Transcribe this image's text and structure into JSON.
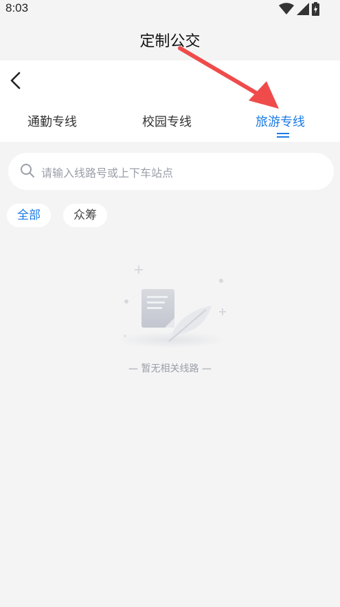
{
  "status_bar": {
    "time": "8:03"
  },
  "header": {
    "title": "定制公交"
  },
  "tabs": [
    {
      "label": "通勤专线",
      "active": false
    },
    {
      "label": "校园专线",
      "active": false
    },
    {
      "label": "旅游专线",
      "active": true
    }
  ],
  "search": {
    "placeholder": "请输入线路号或上下车站点"
  },
  "filters": [
    {
      "label": "全部",
      "selected": true
    },
    {
      "label": "众筹",
      "selected": false
    }
  ],
  "empty_state": {
    "message": "— 暂无相关线路 —"
  },
  "colors": {
    "accent": "#1a7ae6",
    "annotation": "#ef4b4b",
    "background": "#f4f4f4"
  }
}
